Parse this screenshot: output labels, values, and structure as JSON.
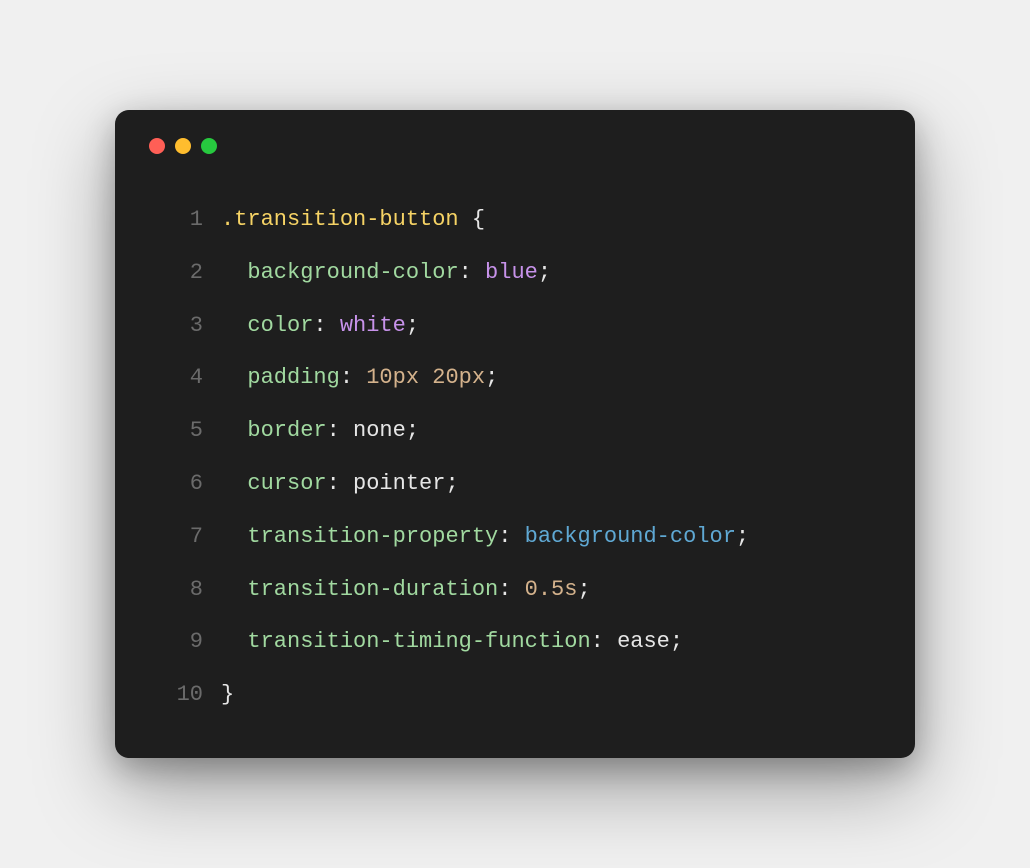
{
  "code": {
    "lines": [
      {
        "n": "1",
        "tokens": [
          {
            "text": ".transition-button",
            "cls": "tok-selector"
          },
          {
            "text": " {",
            "cls": "tok-punct"
          }
        ]
      },
      {
        "n": "2",
        "tokens": [
          {
            "text": "  ",
            "cls": "tok-val"
          },
          {
            "text": "background-color",
            "cls": "tok-prop"
          },
          {
            "text": ":",
            "cls": "tok-colon"
          },
          {
            "text": " ",
            "cls": "tok-val"
          },
          {
            "text": "blue",
            "cls": "tok-color"
          },
          {
            "text": ";",
            "cls": "tok-punct"
          }
        ]
      },
      {
        "n": "3",
        "tokens": [
          {
            "text": "  ",
            "cls": "tok-val"
          },
          {
            "text": "color",
            "cls": "tok-prop"
          },
          {
            "text": ":",
            "cls": "tok-colon"
          },
          {
            "text": " ",
            "cls": "tok-val"
          },
          {
            "text": "white",
            "cls": "tok-color"
          },
          {
            "text": ";",
            "cls": "tok-punct"
          }
        ]
      },
      {
        "n": "4",
        "tokens": [
          {
            "text": "  ",
            "cls": "tok-val"
          },
          {
            "text": "padding",
            "cls": "tok-prop"
          },
          {
            "text": ":",
            "cls": "tok-colon"
          },
          {
            "text": " ",
            "cls": "tok-val"
          },
          {
            "text": "10px 20px",
            "cls": "tok-num"
          },
          {
            "text": ";",
            "cls": "tok-punct"
          }
        ]
      },
      {
        "n": "5",
        "tokens": [
          {
            "text": "  ",
            "cls": "tok-val"
          },
          {
            "text": "border",
            "cls": "tok-prop"
          },
          {
            "text": ":",
            "cls": "tok-colon"
          },
          {
            "text": " none",
            "cls": "tok-val"
          },
          {
            "text": ";",
            "cls": "tok-punct"
          }
        ]
      },
      {
        "n": "6",
        "tokens": [
          {
            "text": "  ",
            "cls": "tok-val"
          },
          {
            "text": "cursor",
            "cls": "tok-prop"
          },
          {
            "text": ":",
            "cls": "tok-colon"
          },
          {
            "text": " pointer",
            "cls": "tok-val"
          },
          {
            "text": ";",
            "cls": "tok-punct"
          }
        ]
      },
      {
        "n": "7",
        "tokens": [
          {
            "text": "  ",
            "cls": "tok-val"
          },
          {
            "text": "transition-property",
            "cls": "tok-prop"
          },
          {
            "text": ":",
            "cls": "tok-colon"
          },
          {
            "text": " ",
            "cls": "tok-val"
          },
          {
            "text": "background-color",
            "cls": "tok-bg"
          },
          {
            "text": ";",
            "cls": "tok-punct"
          }
        ]
      },
      {
        "n": "8",
        "tokens": [
          {
            "text": "  ",
            "cls": "tok-val"
          },
          {
            "text": "transition-duration",
            "cls": "tok-prop"
          },
          {
            "text": ":",
            "cls": "tok-colon"
          },
          {
            "text": " ",
            "cls": "tok-val"
          },
          {
            "text": "0.5s",
            "cls": "tok-num"
          },
          {
            "text": ";",
            "cls": "tok-punct"
          }
        ]
      },
      {
        "n": "9",
        "tokens": [
          {
            "text": "  ",
            "cls": "tok-val"
          },
          {
            "text": "transition-timing-function",
            "cls": "tok-prop"
          },
          {
            "text": ":",
            "cls": "tok-colon"
          },
          {
            "text": " ease",
            "cls": "tok-val"
          },
          {
            "text": ";",
            "cls": "tok-punct"
          }
        ]
      },
      {
        "n": "10",
        "tokens": [
          {
            "text": "}",
            "cls": "tok-punct"
          }
        ]
      }
    ]
  }
}
